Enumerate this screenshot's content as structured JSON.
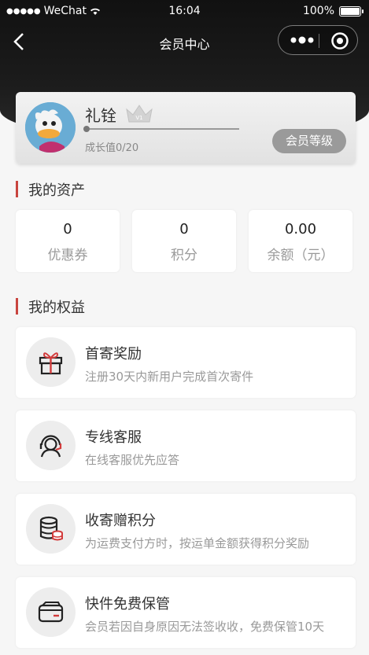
{
  "status_bar": {
    "carrier": "WeChat",
    "time": "16:04",
    "battery": "100%"
  },
  "nav": {
    "title": "会员中心"
  },
  "member": {
    "name": "礼铨",
    "growth_label": "成长值0/20",
    "growth_progress": 0.0,
    "level_button": "会员等级"
  },
  "assets": {
    "section_title": "我的资产",
    "items": [
      {
        "value": "0",
        "label": "优惠券"
      },
      {
        "value": "0",
        "label": "积分"
      },
      {
        "value": "0.00",
        "label": "余额（元）"
      }
    ]
  },
  "benefits": {
    "section_title": "我的权益",
    "items": [
      {
        "icon": "gift-icon",
        "title": "首寄奖励",
        "desc": "注册30天内新用户完成首次寄件"
      },
      {
        "icon": "customer-service-icon",
        "title": "专线客服",
        "desc": "在线客服优先应答"
      },
      {
        "icon": "points-database-icon",
        "title": "收寄赠积分",
        "desc": "为运费支付方时，按运单金额获得积分奖励"
      },
      {
        "icon": "wallet-icon",
        "title": "快件免费保管",
        "desc": "会员若因自身原因无法签收收，免费保管10天"
      }
    ]
  },
  "colors": {
    "accent_red": "#c8453f",
    "header_bg": "#1a1a1a",
    "level_button_bg": "#9a9a9a"
  }
}
